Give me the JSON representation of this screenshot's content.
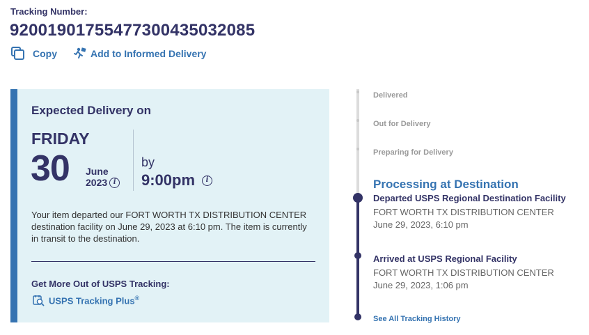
{
  "tracking": {
    "label": "Tracking Number:",
    "number": "9200190175547730043503208​5"
  },
  "actions": {
    "copy_label": "Copy",
    "informed_label": "Add to Informed Delivery"
  },
  "delivery": {
    "title": "Expected Delivery on",
    "day": "FRIDAY",
    "date": "30",
    "month": "June",
    "year": "2023",
    "by": "by",
    "time": "9:00pm",
    "info_glyph": "i",
    "status": "Your item departed our FORT WORTH TX DISTRIBUTION CENTER destination facility on June 29, 2023 at 6:10 pm. The item is currently in transit to the destination.",
    "get_more": "Get More Out of USPS Tracking:",
    "plus_label": "USPS Tracking Plus",
    "plus_mark": "®"
  },
  "timeline": {
    "future_steps": [
      "Delivered",
      "Out for Delivery",
      "Preparing for Delivery"
    ],
    "current_step": "Processing at Destination",
    "events": [
      {
        "title": "Departed USPS Regional Destination Facility",
        "location": "FORT WORTH TX DISTRIBUTION CENTER",
        "datetime": "June 29, 2023, 6:10 pm"
      },
      {
        "title": "Arrived at USPS Regional Facility",
        "location": "FORT WORTH TX DISTRIBUTION CENTER",
        "datetime": "June 29, 2023, 1:06 pm"
      }
    ],
    "history_link": "See All Tracking History"
  },
  "colors": {
    "navy": "#333366",
    "link_blue": "#3573b1",
    "card_bg": "#e2f2f6",
    "muted_grey": "#999999"
  },
  "icons": {
    "copy": "copy-icon",
    "informed": "informed-delivery-icon",
    "info": "info-icon",
    "plus": "tracking-plus-icon"
  }
}
